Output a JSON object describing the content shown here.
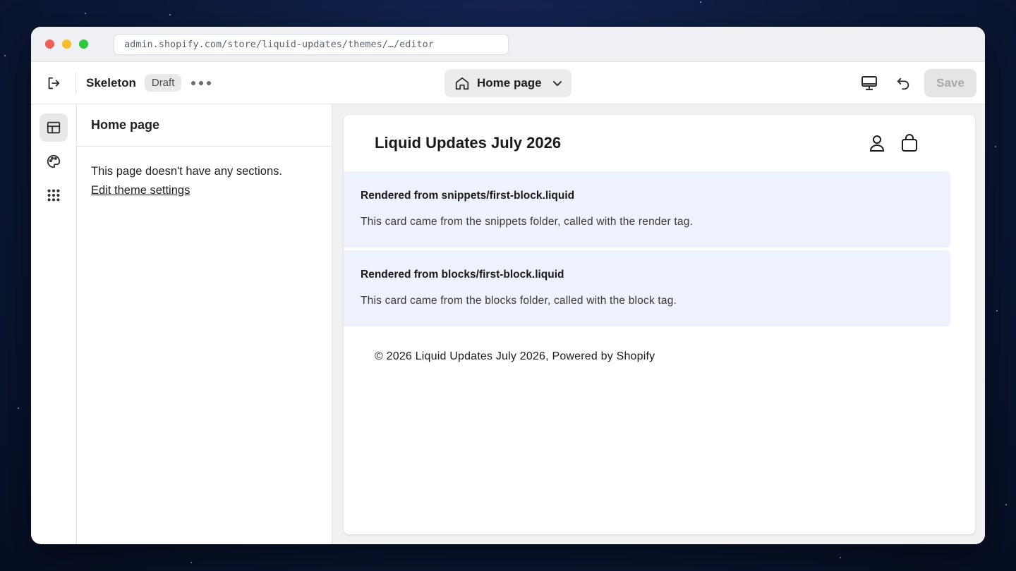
{
  "browser": {
    "url": "admin.shopify.com/store/liquid-updates/themes/…/editor"
  },
  "toolbar": {
    "theme_name": "Skeleton",
    "status_badge": "Draft",
    "page_selector_label": "Home page",
    "save_label": "Save"
  },
  "sidebar": {
    "title": "Home page",
    "empty_message": "This page doesn't have any sections.",
    "link_label": "Edit theme settings"
  },
  "preview": {
    "store_title": "Liquid Updates July 2026",
    "cards": [
      {
        "title": "Rendered from snippets/first-block.liquid",
        "body": "This card came from the snippets folder, called with the render tag."
      },
      {
        "title": "Rendered from blocks/first-block.liquid",
        "body": "This card came from the blocks folder, called with the block tag."
      }
    ],
    "footer": "© 2026 Liquid Updates July 2026, Powered by Shopify"
  },
  "colors": {
    "card_background": "#eef2fd",
    "save_disabled": "#e5e5e5"
  },
  "icons": {
    "exit": "exit-icon",
    "home": "home-icon",
    "desktop": "desktop-icon",
    "undo": "undo-icon",
    "sections": "sections-icon",
    "theme_settings": "palette-icon",
    "apps": "apps-grid-icon",
    "account": "account-icon",
    "cart": "bag-icon"
  }
}
